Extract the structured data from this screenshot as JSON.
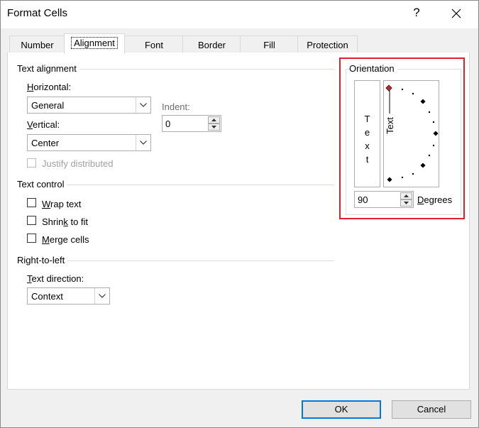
{
  "window": {
    "title": "Format Cells",
    "help_glyph": "?",
    "close_glyph": "✕"
  },
  "tabs": [
    {
      "label": "Number"
    },
    {
      "label": "Alignment"
    },
    {
      "label": "Font"
    },
    {
      "label": "Border"
    },
    {
      "label": "Fill"
    },
    {
      "label": "Protection"
    }
  ],
  "text_alignment": {
    "group_label": "Text alignment",
    "horizontal": {
      "label_u": "H",
      "label_rest": "orizontal:",
      "value": "General"
    },
    "vertical": {
      "label_u": "V",
      "label_rest": "ertical:",
      "value": "Center"
    },
    "indent": {
      "label": "Indent:",
      "value": "0"
    },
    "justify_distributed": {
      "label": "Justify distributed",
      "checked": false,
      "enabled": false
    }
  },
  "text_control": {
    "group_label": "Text control",
    "wrap_text": {
      "label_u": "W",
      "label_rest": "rap text",
      "checked": false
    },
    "shrink_to_fit": {
      "label_pre": "Shrin",
      "label_u": "k",
      "label_rest": " to fit",
      "checked": false
    },
    "merge_cells": {
      "label_u": "M",
      "label_rest": "erge cells",
      "checked": false
    }
  },
  "right_to_left": {
    "group_label": "Right-to-left",
    "text_direction": {
      "label_u": "T",
      "label_rest": "ext direction:",
      "value": "Context"
    }
  },
  "orientation": {
    "group_label": "Orientation",
    "vertical_text": [
      "T",
      "e",
      "x",
      "t"
    ],
    "dial_text": "Text",
    "degrees_value": "90",
    "degrees_label_u": "D",
    "degrees_label_rest": "egrees",
    "highlight_color": "#e0202f",
    "selected_marker_color": "#c0282d"
  },
  "footer": {
    "ok_label": "OK",
    "cancel_label": "Cancel",
    "accent": "#0078d7"
  }
}
